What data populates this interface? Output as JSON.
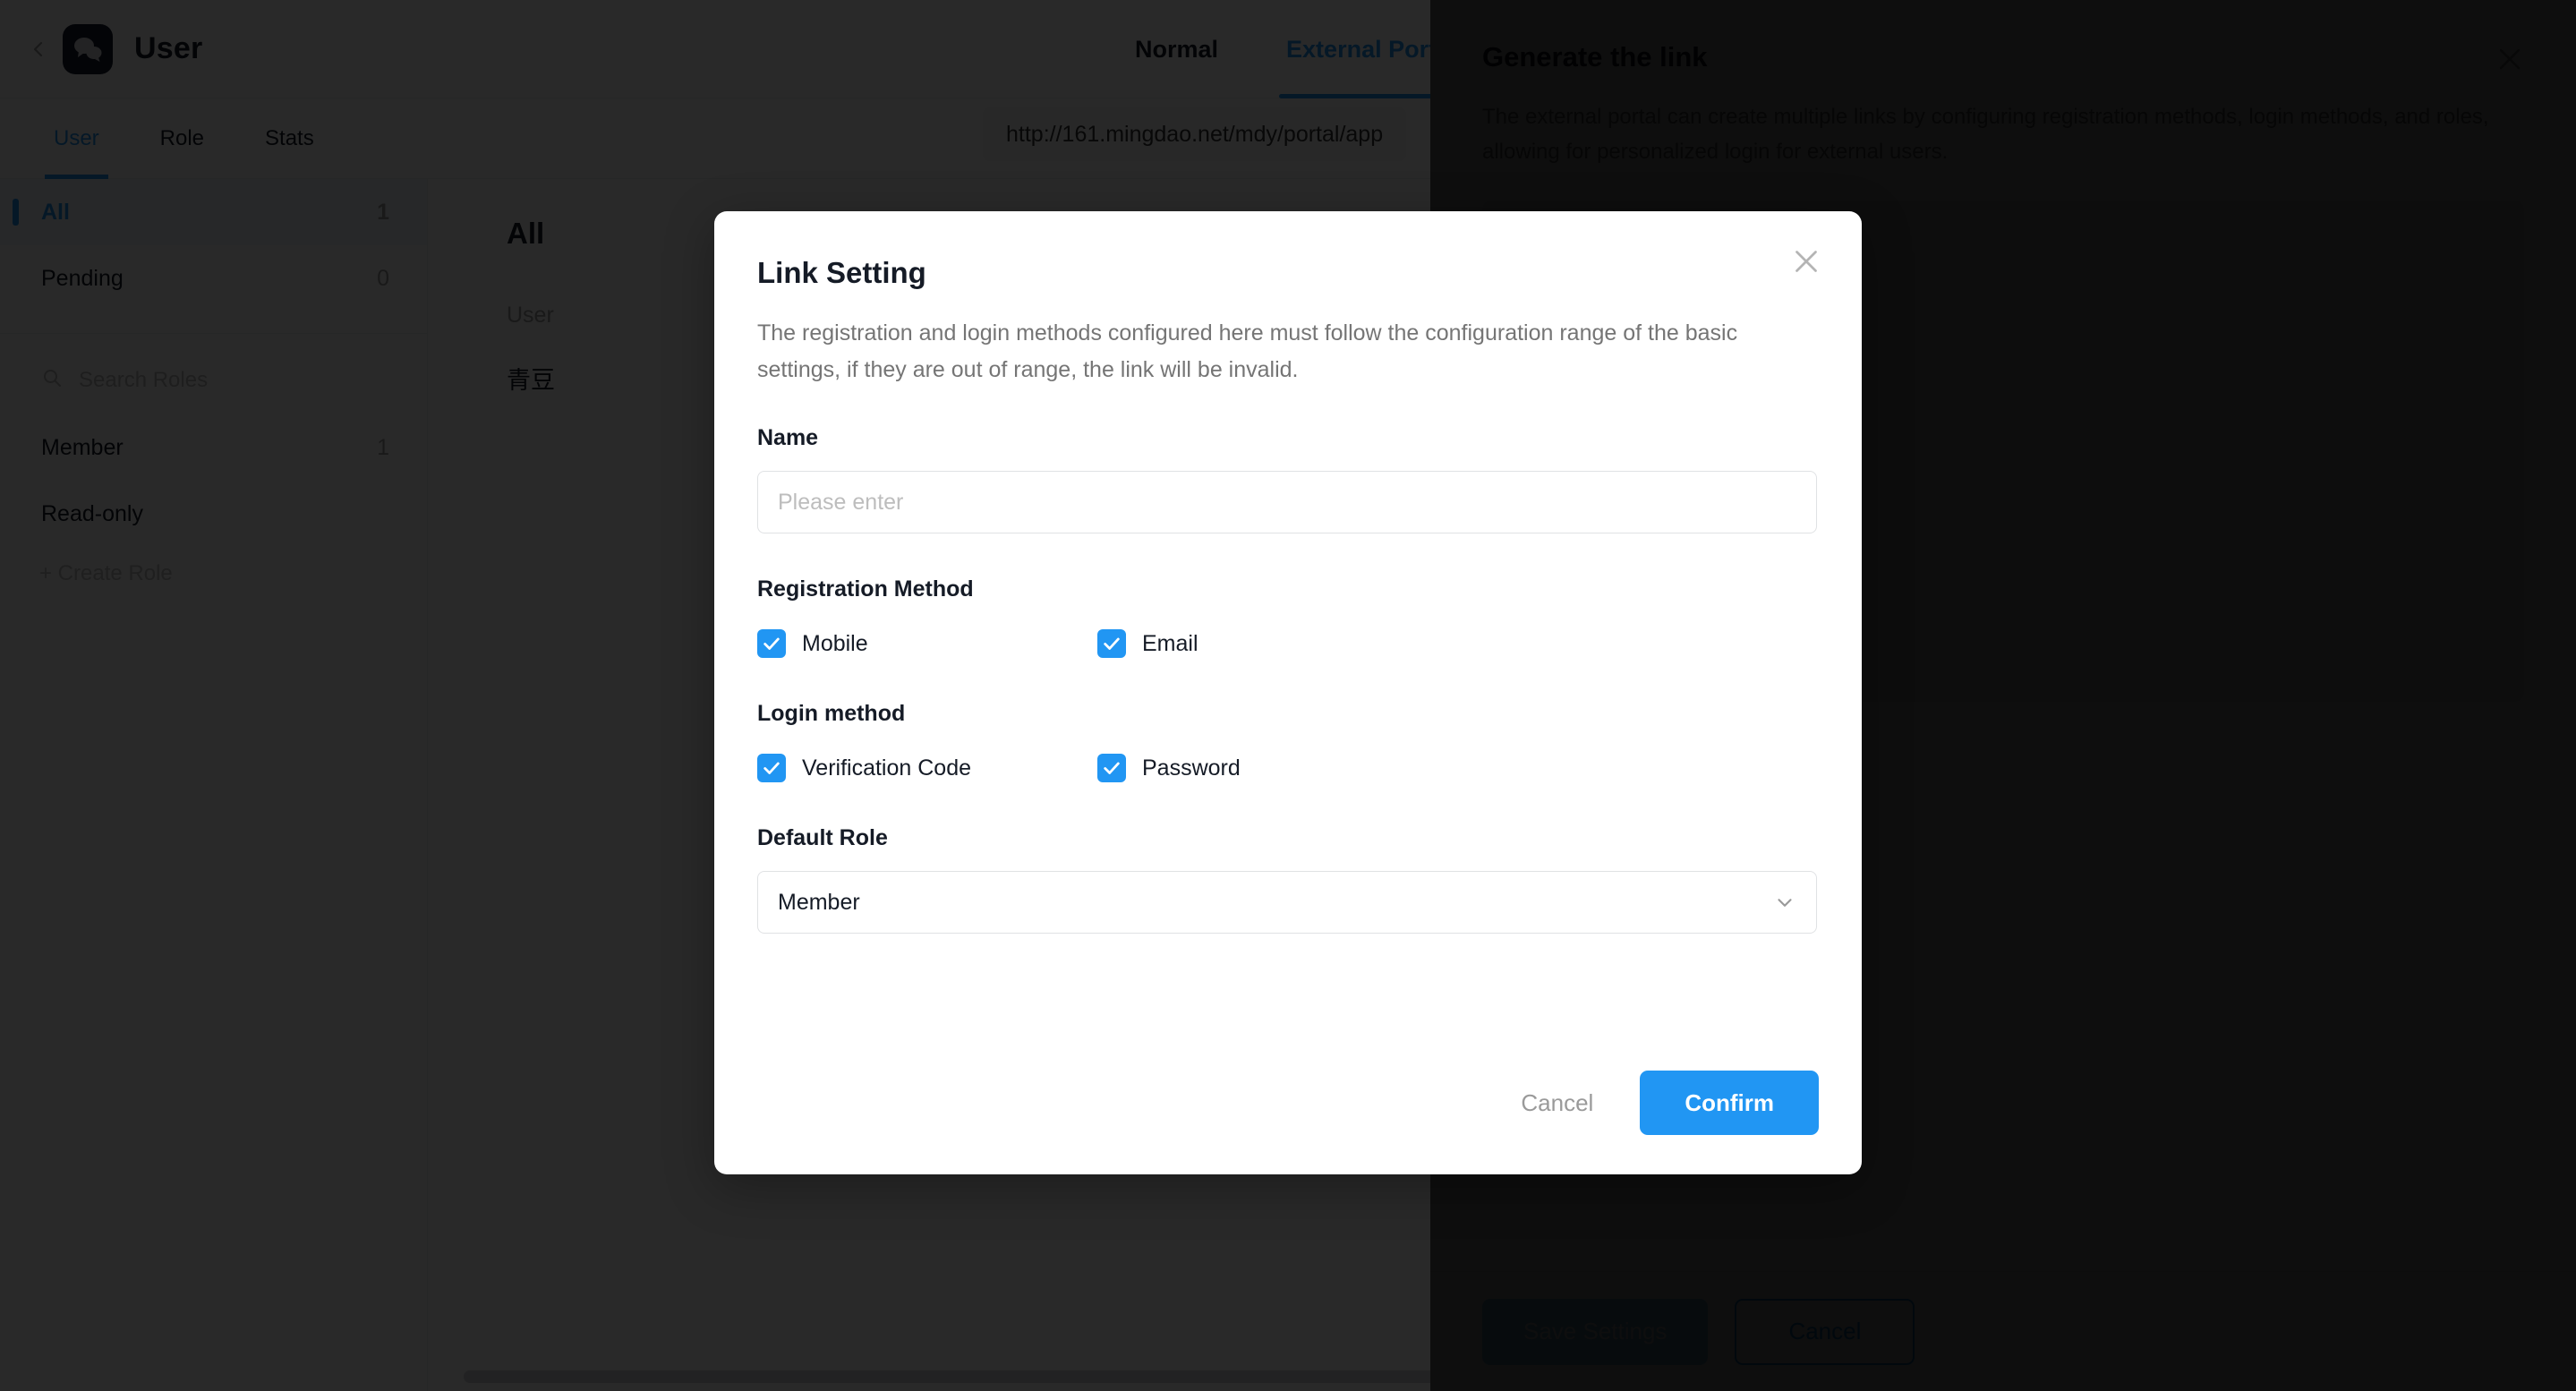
{
  "app": {
    "title": "User",
    "logo_icon": "chat-bubbles-icon",
    "back_icon": "chevron-left-icon",
    "top_tabs": [
      {
        "label": "Normal",
        "active": false
      },
      {
        "label": "External Portal",
        "active": true
      }
    ],
    "url": "http://161.mingdao.net/mdy/portal/app",
    "sub_tabs": [
      {
        "label": "User",
        "active": true
      },
      {
        "label": "Role",
        "active": false
      },
      {
        "label": "Stats",
        "active": false
      }
    ],
    "sidebar": {
      "groups": [
        {
          "label": "All",
          "count": "1",
          "selected": true
        },
        {
          "label": "Pending",
          "count": "0",
          "selected": false
        }
      ],
      "search_placeholder": "Search Roles",
      "search_icon": "search-icon",
      "roles": [
        {
          "label": "Member",
          "count": "1"
        },
        {
          "label": "Read-only",
          "count": ""
        }
      ],
      "create_role_label": "+ Create Role"
    },
    "main": {
      "title": "All",
      "column_header": "User",
      "rows": [
        "青豆"
      ]
    }
  },
  "drawer": {
    "title": "Generate the link",
    "description": "The external portal can create multiple links by configuring registration methods, login methods, and roles, allowing for personalized login for external users.",
    "close_icon": "close-icon",
    "save_label": "Save Settings",
    "cancel_label": "Cancel"
  },
  "modal": {
    "title": "Link Setting",
    "description": "The registration and login methods configured here must follow the configuration range of the basic settings, if they are out of range, the link will be invalid.",
    "close_icon": "close-icon",
    "name": {
      "label": "Name",
      "value": "",
      "placeholder": "Please enter"
    },
    "registration": {
      "label": "Registration Method",
      "options": [
        {
          "label": "Mobile",
          "checked": true
        },
        {
          "label": "Email",
          "checked": true
        }
      ]
    },
    "login": {
      "label": "Login method",
      "options": [
        {
          "label": "Verification Code",
          "checked": true
        },
        {
          "label": "Password",
          "checked": true
        }
      ]
    },
    "default_role": {
      "label": "Default Role",
      "value": "Member",
      "chevron_icon": "chevron-down-icon"
    },
    "cancel_label": "Cancel",
    "confirm_label": "Confirm"
  },
  "colors": {
    "accent": "#2196f3",
    "text": "#151b26",
    "muted": "#757575",
    "logo_bg": "#14192e"
  }
}
